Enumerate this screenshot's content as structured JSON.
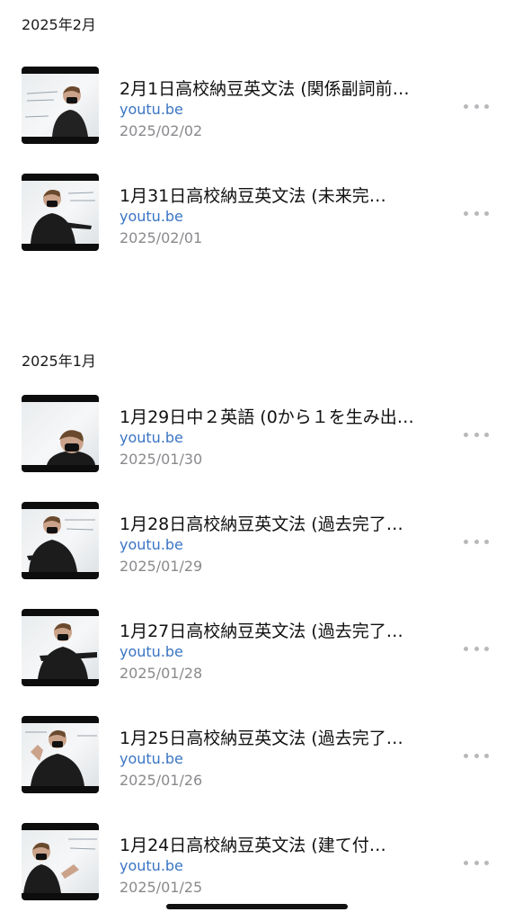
{
  "sections": [
    {
      "header": "2025年2月",
      "items": [
        {
          "title": "2月1日高校納豆英文法 (関係副詞前…",
          "domain": "youtu.be",
          "date": "2025/02/02"
        },
        {
          "title": "1月31日高校納豆英文法 (未来完…",
          "domain": "youtu.be",
          "date": "2025/02/01"
        }
      ]
    },
    {
      "header": "2025年1月",
      "items": [
        {
          "title": "1月29日中２英語 (0から１を生み出…",
          "domain": "youtu.be",
          "date": "2025/01/30"
        },
        {
          "title": "1月28日高校納豆英文法 (過去完了…",
          "domain": "youtu.be",
          "date": "2025/01/29"
        },
        {
          "title": "1月27日高校納豆英文法 (過去完了…",
          "domain": "youtu.be",
          "date": "2025/01/28"
        },
        {
          "title": "1月25日高校納豆英文法 (過去完了…",
          "domain": "youtu.be",
          "date": "2025/01/26"
        },
        {
          "title": "1月24日高校納豆英文法 (建て付…",
          "domain": "youtu.be",
          "date": "2025/01/25"
        }
      ]
    }
  ],
  "colors": {
    "link": "#3a75c4",
    "date": "#8a8a8e",
    "more_dots": "#b8b8bc"
  },
  "icons": {
    "more": "more-horizontal-icon",
    "thumbnail": "video-thumbnail"
  }
}
